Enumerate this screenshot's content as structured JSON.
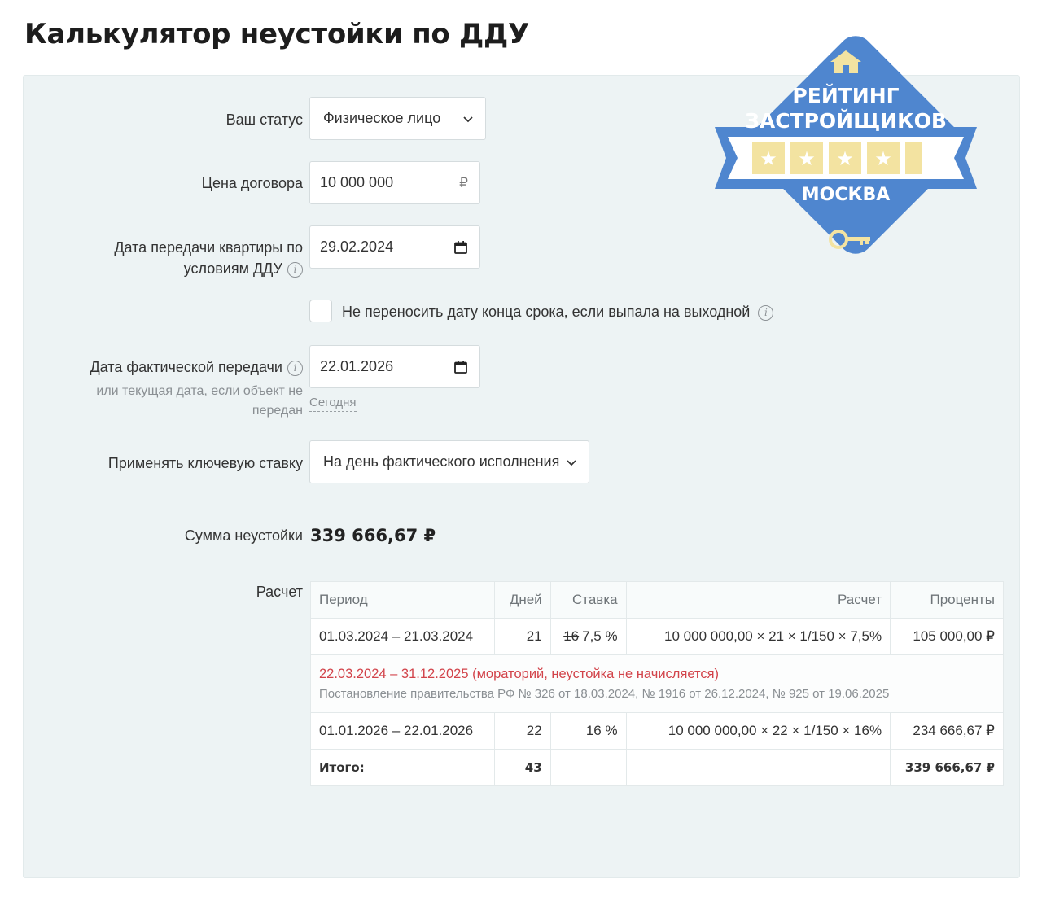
{
  "title": "Калькулятор неустойки по ДДУ",
  "form": {
    "status": {
      "label": "Ваш статус",
      "value": "Физическое лицо"
    },
    "price": {
      "label": "Цена договора",
      "value": "10 000 000",
      "currency": "₽"
    },
    "transfer_date": {
      "label_line1": "Дата передачи квартиры по",
      "label_line2": "условиям ДДУ",
      "value": "29.02.2024"
    },
    "no_shift": {
      "label": "Не переносить дату конца срока, если выпала на выходной",
      "checked": false
    },
    "actual_date": {
      "label": "Дата фактической передачи",
      "hint_line1": "или текущая дата, если объект не",
      "hint_line2": "передан",
      "value": "22.01.2026",
      "today_link": "Сегодня"
    },
    "key_rate": {
      "label": "Применять ключевую ставку",
      "value": "На день фактического исполнения"
    },
    "sum": {
      "label": "Сумма неустойки",
      "value": "339 666,67 ₽"
    },
    "calc_label": "Расчет"
  },
  "table": {
    "headers": {
      "period": "Период",
      "days": "Дней",
      "rate": "Ставка",
      "calc": "Расчет",
      "interest": "Проценты"
    },
    "row1": {
      "period": "01.03.2024 – 21.03.2024",
      "days": "21",
      "rate_old": "16",
      "rate": "7,5 %",
      "calc": "10 000 000,00 × 21 × 1/150 × 7,5%",
      "interest": "105 000,00 ₽"
    },
    "moratorium": {
      "text": "22.03.2024 – 31.12.2025 (мораторий, неустойка не начисляется)",
      "note": "Постановление правительства РФ № 326 от 18.03.2024, № 1916 от 26.12.2024, № 925 от 19.06.2025"
    },
    "row2": {
      "period": "01.01.2026 – 22.01.2026",
      "days": "22",
      "rate": "16 %",
      "calc": "10 000 000,00 × 22 × 1/150 × 16%",
      "interest": "234 666,67 ₽"
    },
    "total": {
      "label": "Итого:",
      "days": "43",
      "interest": "339 666,67 ₽"
    }
  },
  "badge": {
    "line1": "РЕЙТИНГ",
    "line2": "ЗАСТРОЙЩИКОВ",
    "city": "МОСКВА"
  },
  "colors": {
    "panel_bg": "#edf3f4",
    "badge_blue": "#4f86cf",
    "badge_star": "#f3e3a1",
    "moratorium_red": "#d2434a"
  }
}
